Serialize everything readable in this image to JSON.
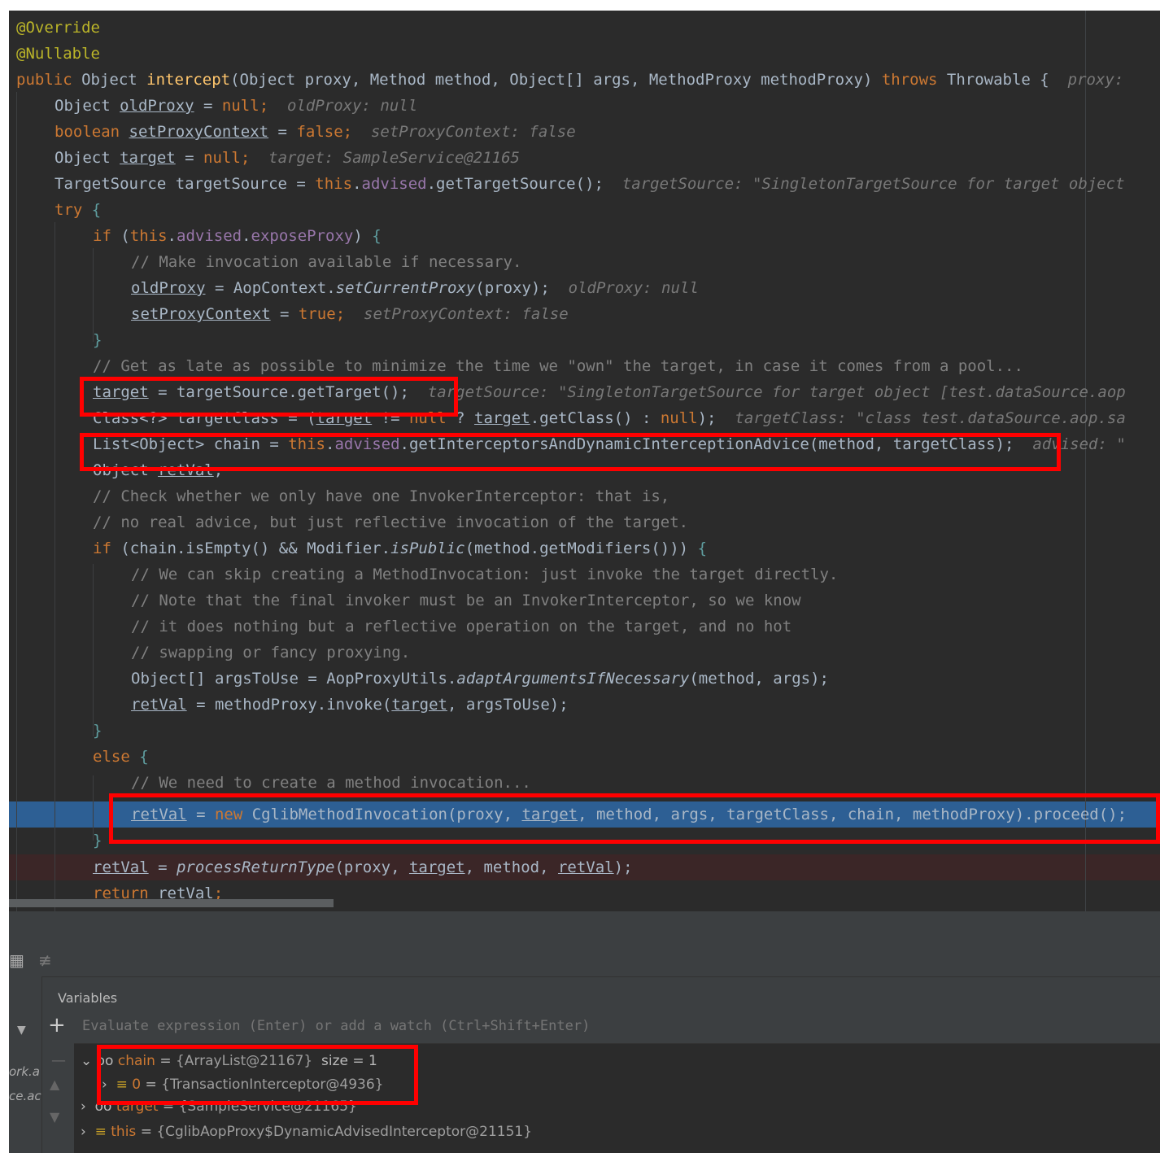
{
  "code": {
    "l1": "@Override",
    "l2": "@Nullable",
    "l3": {
      "public": "public ",
      "t": "Object ",
      "name": "intercept",
      "params": "(Object proxy, Method method, Object[] args, MethodProxy methodProxy) ",
      "throws": "throws ",
      "ex": "Throwable {",
      "hint": "  proxy:"
    },
    "l4": {
      "a": "Object ",
      "v": "oldProxy",
      "b": " = ",
      "n": "null",
      "c": ";",
      "hint": "  oldProxy: null"
    },
    "l5": {
      "a": "boolean ",
      "v": "setProxyContext",
      "b": " = ",
      "n": "false",
      "c": ";",
      "hint": "  setProxyContext: false"
    },
    "l6": {
      "a": "Object ",
      "v": "target",
      "b": " = ",
      "n": "null",
      "c": ";",
      "hint": "  target: SampleService@21165"
    },
    "l7": {
      "a": "TargetSource targetSource = ",
      "this": "this",
      "dot": ".",
      "f": "advised",
      "b": ".getTargetSource();",
      "hint": "  targetSource: \"SingletonTargetSource for target object"
    },
    "l8": {
      "try": "try ",
      "br": "{"
    },
    "l9": {
      "if": "if ",
      "p": "(",
      "this": "this",
      "dot": ".",
      "f1": "advised",
      "dot2": ".",
      "f2": "exposeProxy",
      "e": ") ",
      "br": "{"
    },
    "l10": "// Make invocation available if necessary.",
    "l11": {
      "v": "oldProxy",
      "b": " = AopContext.",
      "m": "setCurrentProxy",
      "c": "(proxy);",
      "hint": "  oldProxy: null"
    },
    "l12": {
      "v": "setProxyContext",
      "b": " = ",
      "n": "true",
      "c": ";",
      "hint": "  setProxyContext: false"
    },
    "l13": "}",
    "l14": "// Get as late as possible to minimize the time we \"own\" the target, in case it comes from a pool...",
    "l15": {
      "v": "target",
      "b": " = targetSource.getTarget();",
      "hint": "  targetSource: \"SingletonTargetSource for target object [test.dataSource.aop"
    },
    "l16": {
      "a": "Class<?> targetClass = (",
      "v1": "target",
      "b": " != ",
      "n": "null",
      "c": " ? ",
      "v2": "target",
      "d": ".getClass() : ",
      "n2": "null",
      "e": ");",
      "hint": "  targetClass: \"class test.dataSource.aop.sa"
    },
    "l17": {
      "a": "List<Object> chain = ",
      "this": "this",
      "dot": ".",
      "f": "advised",
      "b": ".getInterceptorsAndDynamicInterceptionAdvice(method, targetClass);",
      "hint": "  advised: \""
    },
    "l18": {
      "a": "Object ",
      "v": "retVal",
      "c": ";"
    },
    "l19": "// Check whether we only have one InvokerInterceptor: that is,",
    "l20": "// no real advice, but just reflective invocation of the target.",
    "l21": {
      "if": "if ",
      "a": "(chain.isEmpty() && Modifier.",
      "m": "isPublic",
      "b": "(method.getModifiers())) ",
      "br": "{"
    },
    "l22": "// We can skip creating a MethodInvocation: just invoke the target directly.",
    "l23": "// Note that the final invoker must be an InvokerInterceptor, so we know",
    "l24": "// it does nothing but a reflective operation on the target, and no hot",
    "l25": "// swapping or fancy proxying.",
    "l26": {
      "a": "Object[] argsToUse = AopProxyUtils.",
      "m": "adaptArgumentsIfNecessary",
      "b": "(method, args);"
    },
    "l27": {
      "v": "retVal",
      "b": " = methodProxy.invoke(",
      "v2": "target",
      "c": ", argsToUse);"
    },
    "l28": "}",
    "l29": {
      "else": "else ",
      "br": "{"
    },
    "l30": "// We need to create a method invocation...",
    "l31": {
      "v": "retVal",
      "b": " = ",
      "new": "new ",
      "c": "CglibMethodInvocation(proxy, ",
      "v2": "target",
      "d": ", method, args, targetClass, chain, methodProxy).proceed();"
    },
    "l32": "}",
    "l33": {
      "v": "retVal",
      "b": " = ",
      "m": "processReturnType",
      "c": "(proxy, ",
      "v2": "target",
      "d": ", method, ",
      "v3": "retVal",
      "e": ");"
    },
    "l34": {
      "ret": "return ",
      "v": "retVal",
      "c": ";"
    }
  },
  "debugger": {
    "tab_label": "Variables",
    "eval_placeholder": "Evaluate expression (Enter) or add a watch (Ctrl+Shift+Enter)",
    "frames_left": [
      "ork.a",
      "ce.ac"
    ],
    "vars": [
      {
        "name": "chain",
        "eq": " = ",
        "value": "{ArrayList@21167}",
        "extra": "  size = 1"
      },
      {
        "name": "0",
        "eq": " = ",
        "value": "{TransactionInterceptor@4936}"
      },
      {
        "name": "target",
        "eq": " = ",
        "value": "{SampleService@21165}"
      },
      {
        "name": "this",
        "eq": " = ",
        "value": "{CglibAopProxy$DynamicAdvisedInterceptor@21151}"
      }
    ],
    "icons": [
      "table-icon",
      "list-icon",
      "dropdown-icon",
      "plus-icon",
      "minus-icon",
      "up-icon",
      "down-icon",
      "chevron-down-icon",
      "chevron-right-icon",
      "watch-icon",
      "field-icon"
    ]
  },
  "colors": {
    "highlight_box": "#ff0000",
    "exec_line": "#2d5f94",
    "breakpoint_line": "#3b2627"
  }
}
